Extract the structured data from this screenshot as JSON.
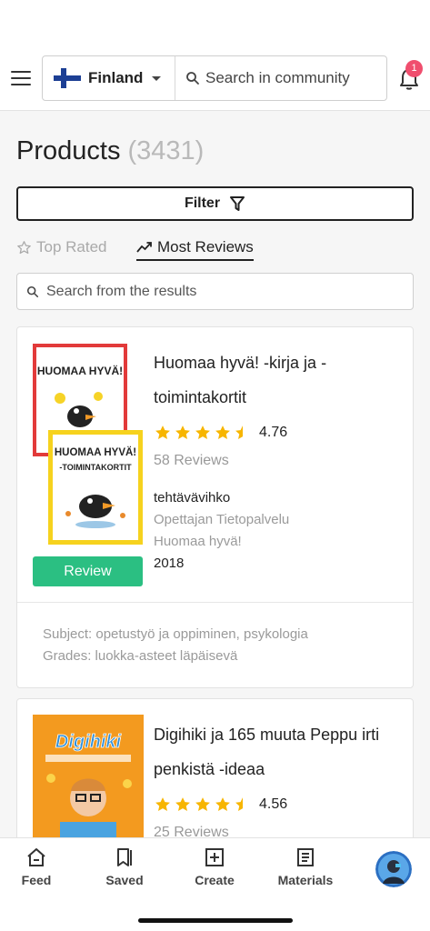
{
  "header": {
    "country": "Finland",
    "search_placeholder": "Search in community",
    "notification_count": "1"
  },
  "products": {
    "title": "Products",
    "count": "(3431)",
    "filter_label": "Filter",
    "tabs": [
      {
        "label": "Top Rated",
        "active": false
      },
      {
        "label": "Most Reviews",
        "active": true
      }
    ],
    "results_placeholder": "Search from the results",
    "items": [
      {
        "title": "Huomaa hyvä! -kirja ja -toimintakortit",
        "rating": "4.76",
        "rating_value": 4.76,
        "reviews": "58 Reviews",
        "type": "tehtävävihko",
        "publisher": "Opettajan Tietopalvelu",
        "series": "Huomaa hyvä!",
        "year": "2018",
        "review_button": "Review",
        "subject": "Subject: opetustyö ja oppiminen, psykologia",
        "grades": "Grades: luokka-asteet läpäisevä",
        "cover_text_1": "HUOMAA HYVÄ!",
        "cover_text_2": "HUOMAA HYVÄ!",
        "cover_subtitle_2": "-TOIMINTAKORTIT"
      },
      {
        "title": "Digihiki ja 165 muuta Peppu irti penkistä -ideaa",
        "rating": "4.56",
        "rating_value": 4.56,
        "reviews": "25 Reviews",
        "cover_text": "Digihiki"
      }
    ]
  },
  "nav": {
    "items": [
      {
        "label": "Feed",
        "icon": "home-icon"
      },
      {
        "label": "Saved",
        "icon": "bookmark-icon"
      },
      {
        "label": "Create",
        "icon": "plus-square-icon"
      },
      {
        "label": "Materials",
        "icon": "document-icon"
      }
    ]
  },
  "colors": {
    "accent_green": "#2bbf82",
    "star": "#f7b500",
    "badge": "#f04e6e"
  }
}
